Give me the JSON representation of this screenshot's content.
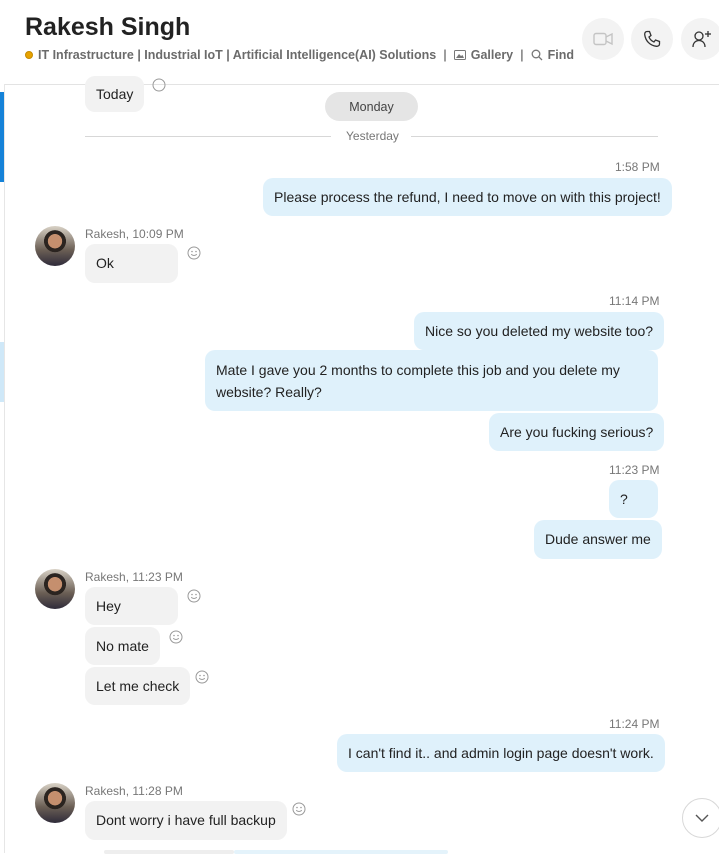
{
  "header": {
    "title": "Rakesh Singh",
    "mood": "IT Infrastructure | Industrial IoT | Artificial Intelligence(AI) Solutions",
    "separator": "|",
    "gallery_label": "Gallery",
    "find_label": "Find"
  },
  "chat": {
    "top_partial_message": "Today",
    "day_pill": "Monday",
    "day_divider": "Yesterday",
    "groups": {
      "g1_time": "1:58 PM",
      "g1_m1": "Please process the refund, I need to move on with this project!",
      "g2_sender": "Rakesh, 10:09 PM",
      "g2_m1": "Ok",
      "g3_time": "11:14 PM",
      "g3_m1": "Nice so you deleted my website too?",
      "g3_m2_line1": "Mate I gave you 2 months to complete this job and you delete my",
      "g3_m2_line2": "website? Really?",
      "g3_m3": "Are you fucking serious?",
      "g4_time": "11:23 PM",
      "g4_m1": "?",
      "g4_m2": "Dude answer me",
      "g5_sender": "Rakesh, 11:23 PM",
      "g5_m1": "Hey",
      "g5_m2": "No mate",
      "g5_m3": "Let me check",
      "g6_time": "11:24 PM",
      "g6_m1": "I can't find it.. and admin login page doesn't work.",
      "g7_sender": "Rakesh, 11:28 PM",
      "g7_m1": "Dont worry i have full backup"
    }
  },
  "colors": {
    "outgoing_bubble": "#dff1fb",
    "incoming_bubble": "#f2f2f2",
    "accent": "#1582d8",
    "mood_dot": "#e8a300"
  },
  "icons": [
    "video-call-icon",
    "audio-call-icon",
    "add-people-icon",
    "gallery-icon",
    "find-icon",
    "smiley-react-icon",
    "scroll-down-icon"
  ]
}
